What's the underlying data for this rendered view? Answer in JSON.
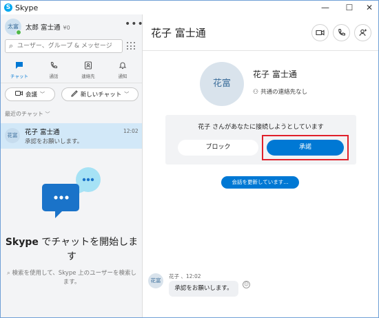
{
  "window": {
    "title": "Skype",
    "app_icon_glyph": "S",
    "controls": {
      "minimize": "—",
      "maximize": "☐",
      "close": "✕"
    }
  },
  "sidebar": {
    "me": {
      "avatar_text": "太富",
      "name": "太郎 富士通",
      "credit": "¥0",
      "status_color": "#4fb848"
    },
    "more_label": "•••",
    "search": {
      "placeholder": "ユーザー、グループ & メッセージ"
    },
    "tabs": [
      {
        "label": "チャット",
        "icon": "chat-icon",
        "active": true
      },
      {
        "label": "通話",
        "icon": "phone-icon",
        "active": false
      },
      {
        "label": "連絡先",
        "icon": "contacts-icon",
        "active": false
      },
      {
        "label": "通知",
        "icon": "bell-icon",
        "active": false
      }
    ],
    "meet_button": "会議",
    "new_chat_button": "新しいチャット",
    "recent_label": "最近のチャット",
    "chats": [
      {
        "avatar_text": "花富",
        "name": "花子 富士通",
        "preview": "承認をお願いします。",
        "time": "12:02"
      }
    ],
    "empty_state": {
      "title_brand": "Skype",
      "title_rest": " でチャットを開始します",
      "description": "検索を使用して、Skype 上のユーザーを検索します。"
    }
  },
  "main": {
    "contact_name": "花子 富士通",
    "profile": {
      "avatar_text": "花富",
      "name": "花子 富士通",
      "subtitle": "共通の連絡先なし"
    },
    "request": {
      "text": "花子 さんがあなたに接続しようとしています",
      "block_label": "ブロック",
      "accept_label": "承諾"
    },
    "updating_label": "会話を更新しています...",
    "message": {
      "avatar_text": "花富",
      "meta": "花子 、12:02",
      "text": "承認をお願いします。"
    }
  },
  "colors": {
    "accent": "#0078d4",
    "highlight_frame": "#e0202a",
    "selected_chat": "#d2e8f8"
  }
}
